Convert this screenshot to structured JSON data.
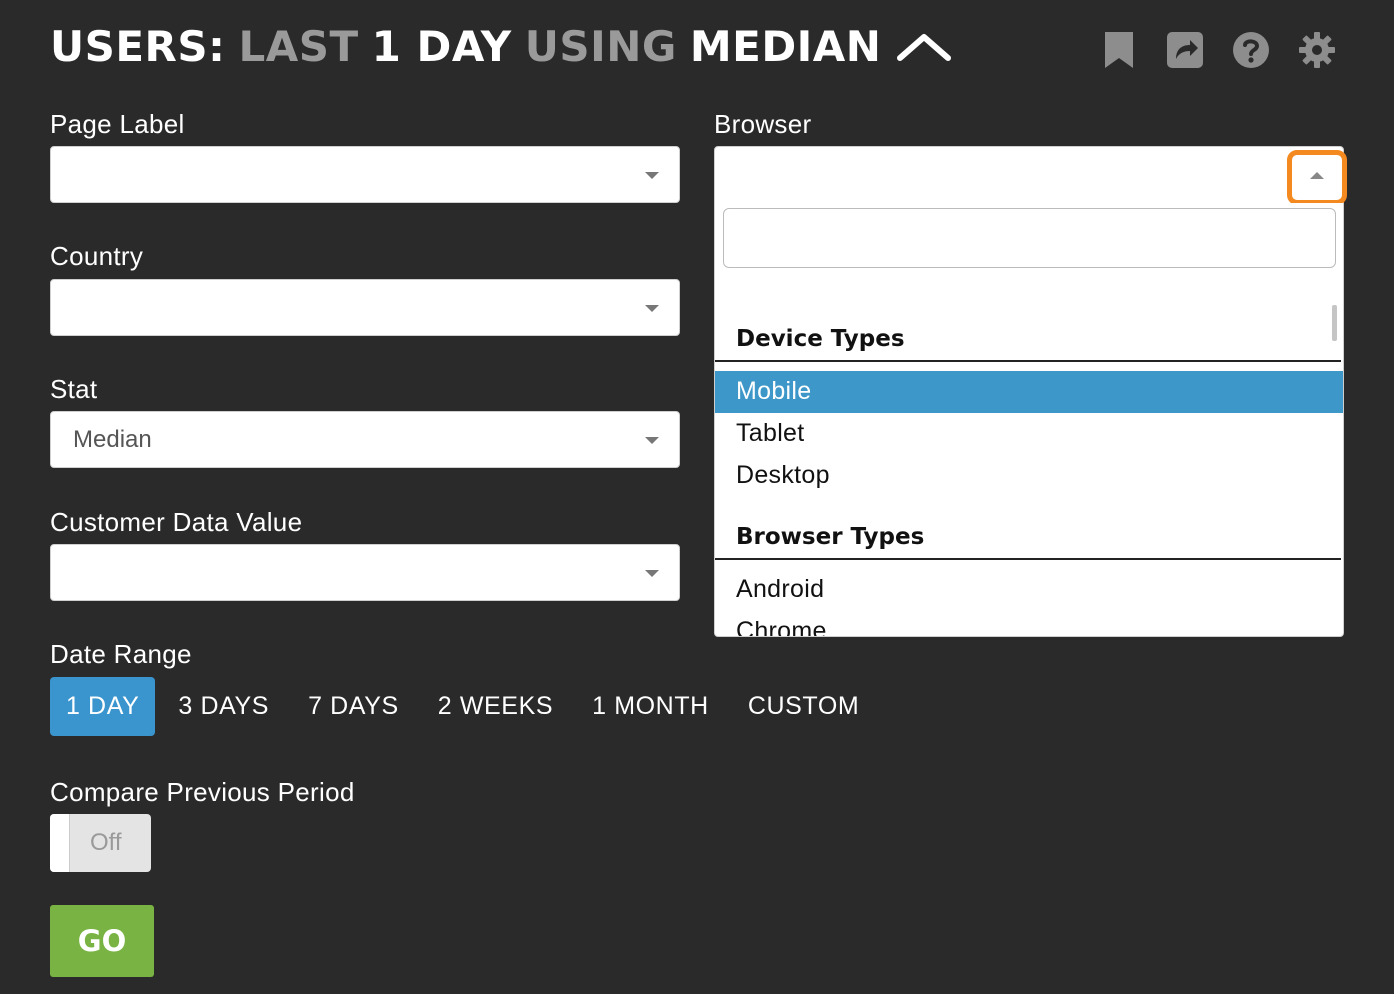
{
  "header": {
    "title_parts": {
      "users": "USERS:",
      "last": "LAST",
      "period": "1 DAY",
      "using": "USING",
      "stat": "MEDIAN"
    },
    "icons": [
      "bookmark-icon",
      "share-icon",
      "help-icon",
      "settings-icon"
    ]
  },
  "filters": {
    "page_label": {
      "label": "Page Label",
      "value": ""
    },
    "country": {
      "label": "Country",
      "value": ""
    },
    "stat": {
      "label": "Stat",
      "value": "Median"
    },
    "customer_data_value": {
      "label": "Customer Data Value",
      "value": ""
    },
    "browser": {
      "label": "Browser",
      "value": "",
      "search_value": "",
      "groups": [
        {
          "label": "Device Types",
          "options": [
            "Mobile",
            "Tablet",
            "Desktop"
          ]
        },
        {
          "label": "Browser Types",
          "options": [
            "Android",
            "Chrome"
          ]
        }
      ],
      "highlighted": "Mobile"
    }
  },
  "date_range": {
    "label": "Date Range",
    "options": [
      "1 DAY",
      "3 DAYS",
      "7 DAYS",
      "2 WEEKS",
      "1 MONTH",
      "CUSTOM"
    ],
    "selected": "1 DAY"
  },
  "compare": {
    "label": "Compare Previous Period",
    "state": "Off"
  },
  "go_label": "GO",
  "colors": {
    "background": "#2a2a2a",
    "accent_blue": "#3a94cd",
    "go_green": "#79b343",
    "focus_orange": "#f4891f",
    "muted_title": "#9a9a9a"
  }
}
